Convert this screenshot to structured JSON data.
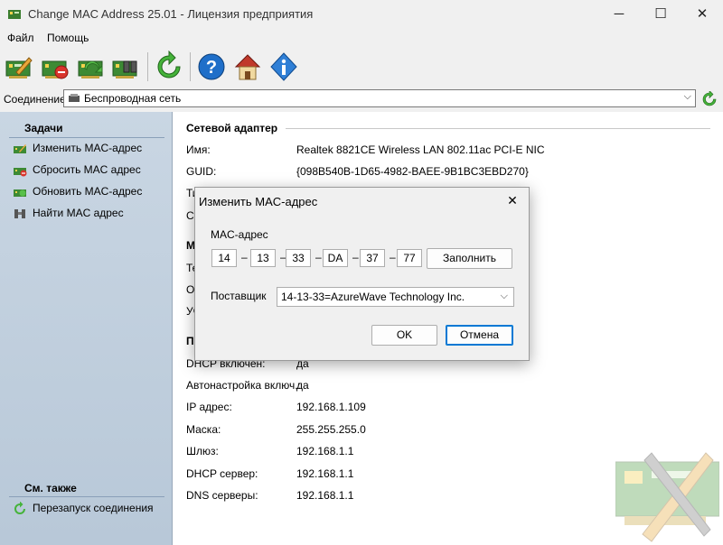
{
  "window": {
    "title": "Change MAC Address 25.01 - Лицензия предприятия",
    "minimize_glyph": "─",
    "maximize_glyph": "☐",
    "close_glyph": "✕"
  },
  "menu": {
    "items": [
      "Файл",
      "Помощь"
    ]
  },
  "toolbar": {
    "buttons": [
      "change-mac-icon",
      "reset-mac-icon",
      "update-mac-icon",
      "find-mac-icon",
      "refresh-icon",
      "help-icon",
      "home-icon",
      "info-icon"
    ]
  },
  "connection": {
    "label": "Соединение:",
    "value": "Беспроводная сеть",
    "chevron": "⌵"
  },
  "tasks": {
    "heading": "Задачи",
    "items": [
      "Изменить MAC-адрес",
      "Сбросить MAC адрес",
      "Обновить MAC-адрес",
      "Найти MAC адрес"
    ]
  },
  "see_also": {
    "heading": "См. также",
    "items": [
      "Перезапуск соединения"
    ]
  },
  "adapter": {
    "section_title": "Сетевой адаптер",
    "rows": [
      {
        "label": "Имя:",
        "value": "Realtek 8821CE Wireless LAN 802.11ac PCI-E NIC"
      },
      {
        "label": "GUID:",
        "value": "{098B540B-1D65-4982-BAEE-9B1BC3EBD270}"
      },
      {
        "label": "Ти",
        "value": ""
      },
      {
        "label": "Ст",
        "value": ""
      }
    ]
  },
  "mac_section": {
    "title_fragment": "M",
    "rows": [
      {
        "label": "Те"
      },
      {
        "label": "Ор"
      },
      {
        "label": "Уч"
      }
    ]
  },
  "params_section": {
    "title_fragment": "П",
    "rows": [
      {
        "label": "DHCP включен:",
        "value": "да"
      },
      {
        "label": "Автонастройка включ.:",
        "value": "да"
      },
      {
        "label": "IP адрес:",
        "value": "192.168.1.109"
      },
      {
        "label": "Маска:",
        "value": "255.255.255.0"
      },
      {
        "label": "Шлюз:",
        "value": "192.168.1.1"
      },
      {
        "label": "DHCP сервер:",
        "value": "192.168.1.1"
      },
      {
        "label": "DNS серверы:",
        "value": "192.168.1.1"
      }
    ]
  },
  "dialog": {
    "title": "Изменить MAC-адрес",
    "close_glyph": "✕",
    "mac_label": "MAC-адрес",
    "octets": [
      "14",
      "13",
      "33",
      "DA",
      "37",
      "77"
    ],
    "separator": "–",
    "fill_button": "Заполнить",
    "vendor_label": "Поставщик",
    "vendor_value": "14-13-33=AzureWave Technology Inc.",
    "vendor_chevron": "⌵",
    "ok_button": "OK",
    "cancel_button": "Отмена"
  },
  "colors": {
    "left_panel": "#c4d2e0",
    "accent": "#0078d4",
    "help_icon": "#1f6fc9",
    "refresh_icon": "#3aa52c"
  }
}
